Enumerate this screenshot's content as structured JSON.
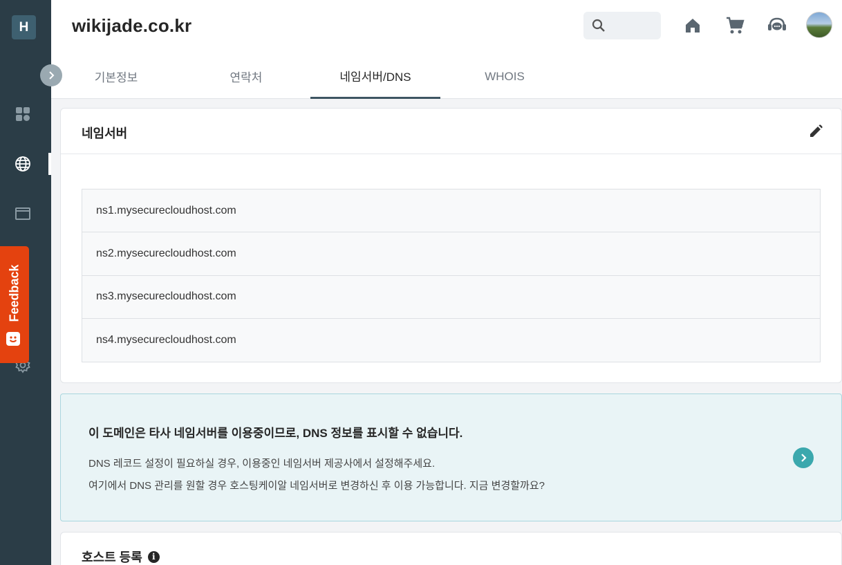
{
  "sidebar": {
    "logo_letter": "H",
    "icons": [
      "dashboard-icon",
      "globe-icon",
      "window-icon",
      "settings-icon"
    ],
    "expand_icon": "chevron-right-icon",
    "feedback_label": "Feedback"
  },
  "header": {
    "domain": "wikijade.co.kr",
    "search_icon": "search-icon",
    "actions": [
      "home-icon",
      "cart-icon",
      "support-icon",
      "avatar"
    ]
  },
  "tabs": [
    {
      "label": "기본정보",
      "active": false
    },
    {
      "label": "연락처",
      "active": false
    },
    {
      "label": "네임서버/DNS",
      "active": true
    },
    {
      "label": "WHOIS",
      "active": false
    }
  ],
  "nameserver": {
    "title": "네임서버",
    "edit_icon": "pencil-icon",
    "servers": [
      "ns1.mysecurecloudhost.com",
      "ns2.mysecurecloudhost.com",
      "ns3.mysecurecloudhost.com",
      "ns4.mysecurecloudhost.com"
    ]
  },
  "notice": {
    "title": "이 도메인은 타사 네임서버를 이용중이므로, DNS 정보를 표시할 수 없습니다.",
    "line1": "DNS 레코드 설정이 필요하실 경우, 이용중인 네임서버 제공사에서 설정해주세요.",
    "line2": "여기에서 DNS 관리를 원할 경우 호스팅케이알 네임서버로 변경하신 후 이용 가능합니다. 지금 변경할까요?"
  },
  "host": {
    "title": "호스트 등록",
    "info_glyph": "i"
  },
  "colors": {
    "sidebar": "#2b3d47",
    "feedback": "#e4420f",
    "notice_bg": "#e9f4f6",
    "accent": "#3ba8ad"
  }
}
